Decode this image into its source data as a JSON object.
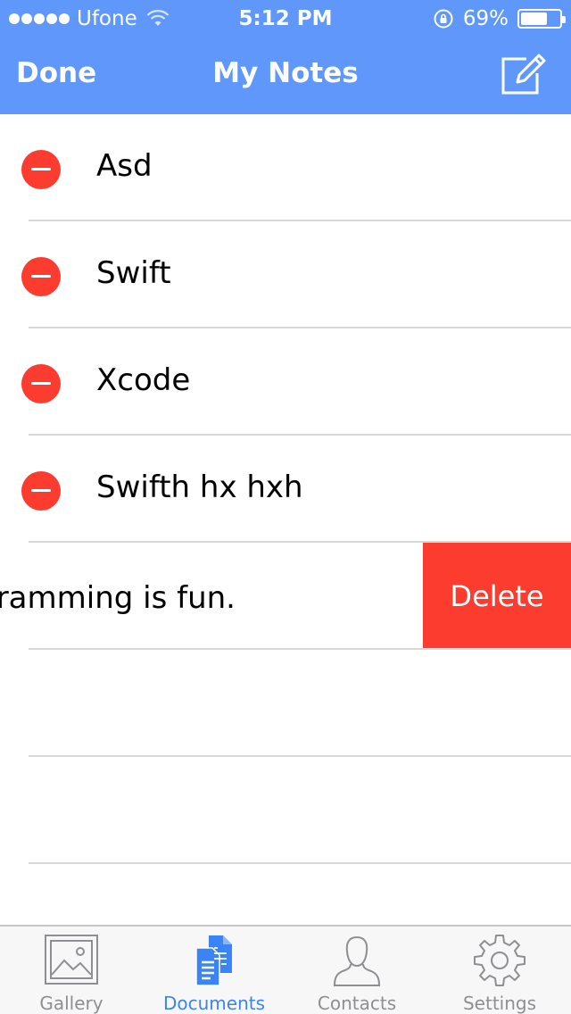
{
  "status_bar": {
    "carrier": "Ufone",
    "time": "5:12 PM",
    "battery_percent": "69%",
    "battery_level": 0.69
  },
  "nav": {
    "done_label": "Done",
    "title": "My Notes",
    "compose_icon": "compose-icon"
  },
  "notes": [
    "Asd",
    "Swift",
    "Xcode",
    "Swifth hx hxh",
    "gramming is fun."
  ],
  "swipe_action": {
    "delete_label": "Delete"
  },
  "tabs": [
    {
      "label": "Gallery",
      "icon": "gallery-icon",
      "active": false
    },
    {
      "label": "Documents",
      "icon": "documents-icon",
      "active": true
    },
    {
      "label": "Contacts",
      "icon": "contacts-icon",
      "active": false
    },
    {
      "label": "Settings",
      "icon": "settings-icon",
      "active": false
    }
  ],
  "colors": {
    "nav_background": "#5f97fb",
    "destructive": "#fd3c30",
    "tab_active": "#3b84f5",
    "tab_inactive": "#8e8e93"
  }
}
